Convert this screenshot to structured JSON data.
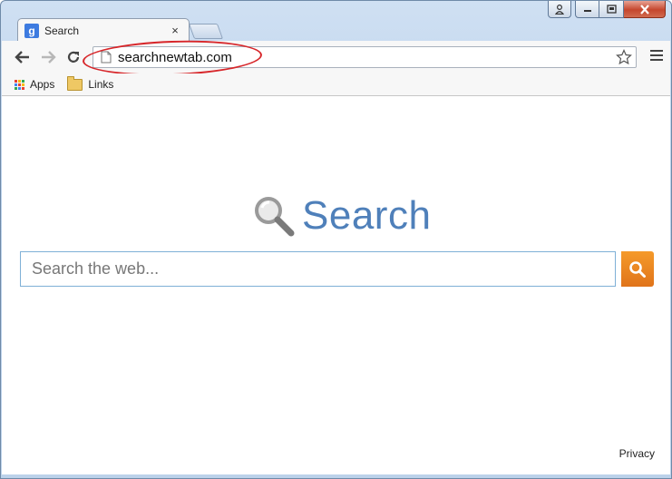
{
  "tab": {
    "title": "Search",
    "favicon_letter": "g",
    "close_glyph": "×"
  },
  "toolbar": {
    "url": "searchnewtab.com"
  },
  "bookmarks": [
    {
      "label": "Apps"
    },
    {
      "label": "Links"
    }
  ],
  "main": {
    "logo_text": "Search",
    "search_placeholder": "Search the web...",
    "privacy_link": "Privacy"
  },
  "colors": {
    "brand_blue": "#4f80ba",
    "search_button": "#f0861f",
    "annotation": "#d7262a"
  },
  "icons": [
    "user-icon",
    "minimize-icon",
    "maximize-icon",
    "close-icon",
    "back-arrow-icon",
    "forward-arrow-icon",
    "reload-icon",
    "page-icon",
    "star-icon",
    "menu-icon",
    "apps-icon",
    "folder-icon",
    "magnifier-icon",
    "search-icon"
  ]
}
